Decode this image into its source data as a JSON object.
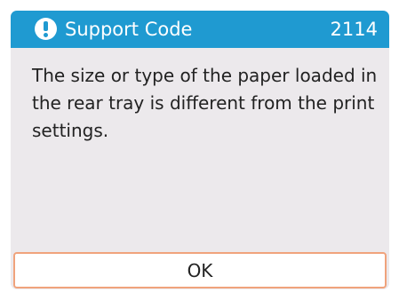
{
  "dialog": {
    "title": "Support Code",
    "code": "2114",
    "icon": "exclamation-circle-icon",
    "message": "The size or type of the paper loaded in the rear tray is different from the print settings.",
    "ok_label": "OK"
  },
  "colors": {
    "header_background": "#1f9ad1",
    "dialog_background": "#ece9ec",
    "button_border": "#f0a37c",
    "button_background": "#ffffff",
    "text": "#222222"
  }
}
